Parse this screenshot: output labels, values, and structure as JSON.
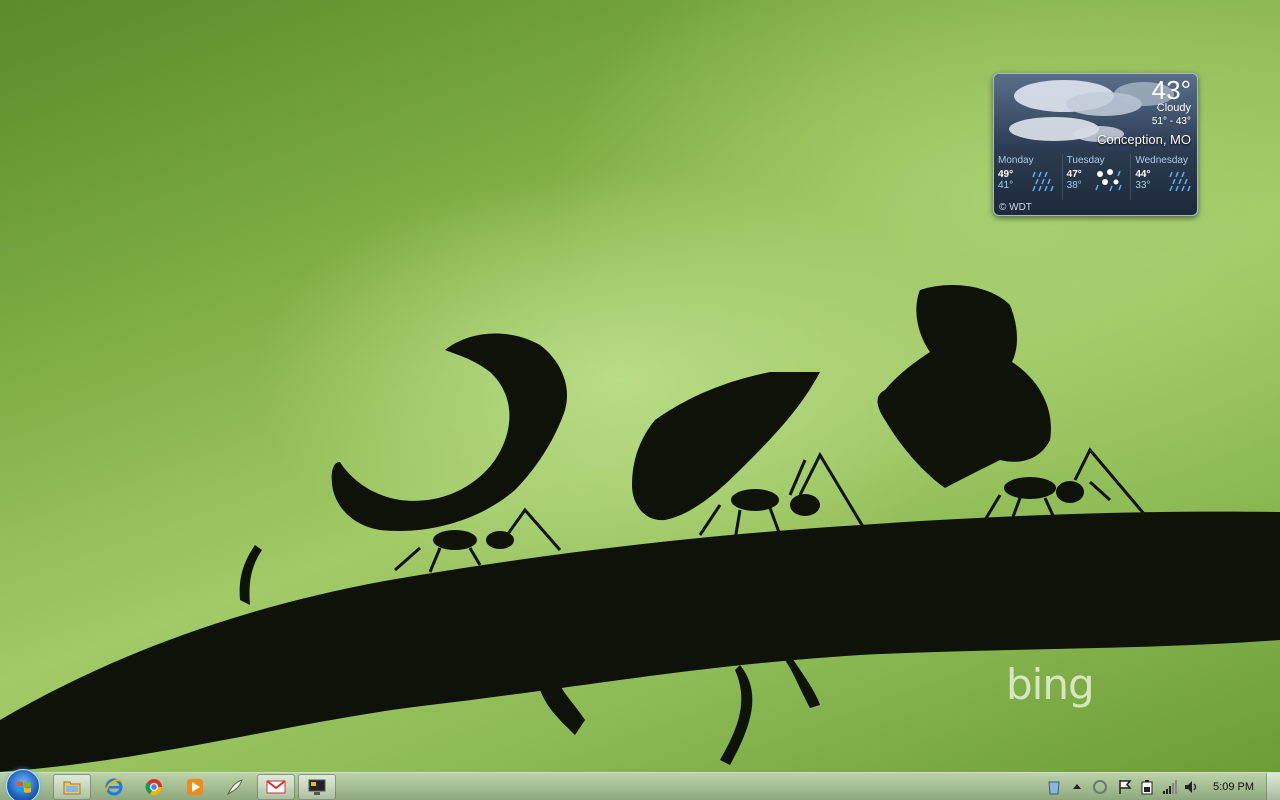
{
  "wallpaper": {
    "brand_text": "bing",
    "description_colors": {
      "light": "#b9dc86",
      "dark": "#5a8a2a",
      "silhouette": "#0e1208"
    }
  },
  "weather": {
    "current_temp": "43°",
    "condition": "Cloudy",
    "range": "51° - 43°",
    "location": "Conception, MO",
    "credit": "© WDT",
    "forecast": [
      {
        "day": "Monday",
        "high": "49°",
        "low": "41°",
        "icon": "rain-icon"
      },
      {
        "day": "Tuesday",
        "high": "47°",
        "low": "38°",
        "icon": "snow-rain-icon"
      },
      {
        "day": "Wednesday",
        "high": "44°",
        "low": "33°",
        "icon": "rain-icon"
      }
    ]
  },
  "taskbar": {
    "start_icon": "windows-orb-icon",
    "pinned": [
      {
        "name": "windows-explorer",
        "icon": "folder-icon",
        "open": true
      },
      {
        "name": "internet-explorer",
        "icon": "ie-icon",
        "open": false
      },
      {
        "name": "chrome",
        "icon": "chrome-icon",
        "open": false
      },
      {
        "name": "media-player",
        "icon": "media-player-icon",
        "open": false
      },
      {
        "name": "app-5",
        "icon": "feather-icon",
        "open": false
      },
      {
        "name": "gmail",
        "icon": "gmail-icon",
        "open": true
      },
      {
        "name": "app-7",
        "icon": "monitor-icon",
        "open": true
      }
    ],
    "tray": [
      "recycle-icon",
      "show-hidden-icon",
      "sync-icon",
      "action-center-flag-icon",
      "battery-icon",
      "network-icon",
      "volume-icon"
    ],
    "clock": "5:09 PM"
  }
}
